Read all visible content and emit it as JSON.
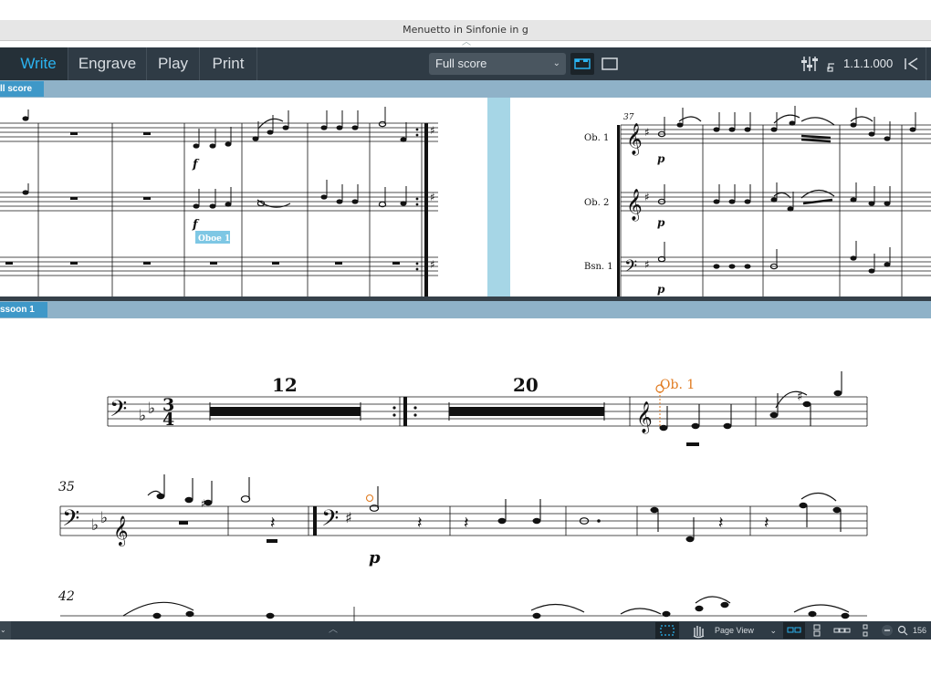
{
  "window": {
    "title": "Menuetto in Sinfonie in g"
  },
  "toolbar": {
    "modes": [
      {
        "label": "Write",
        "active": true
      },
      {
        "label": "Engrave",
        "active": false
      },
      {
        "label": "Play",
        "active": false
      },
      {
        "label": "Print",
        "active": false
      }
    ],
    "layout_select": "Full score",
    "position": "1.1.1.000"
  },
  "upper_view": {
    "tab_label": "ll score",
    "instrument_labels": [
      "Ob. 1",
      "Ob. 2",
      "Bsn. 1"
    ],
    "bar_number": "37",
    "dynamics": {
      "f": "f",
      "p": "p"
    },
    "tooltip": "Oboe 1"
  },
  "lower_view": {
    "tab_label": "ssoon 1",
    "multirest_counts": [
      "12",
      "20"
    ],
    "cue_label": "Ob. 1",
    "system_numbers": [
      "35",
      "42"
    ],
    "dynamic_p": "p",
    "time_signature": {
      "top": "3",
      "bottom": "4"
    }
  },
  "statusbar": {
    "page_view": "Page View",
    "zoom": "156"
  },
  "colors": {
    "accent": "#2bb3f0",
    "toolbar": "#2f3b45",
    "tab": "#3f98c8",
    "cue": "#e07a1f"
  }
}
